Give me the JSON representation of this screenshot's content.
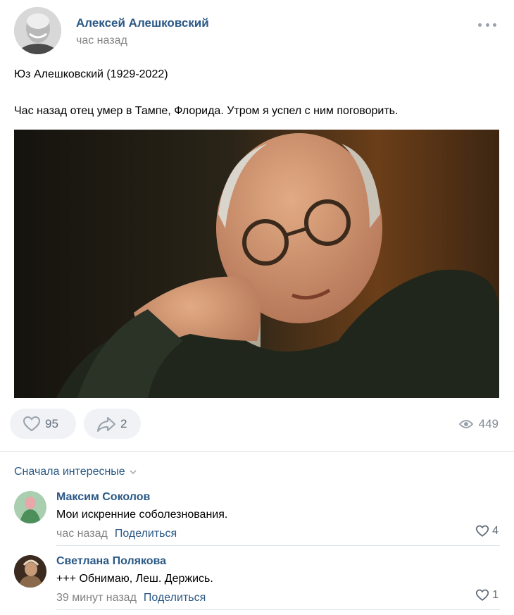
{
  "post": {
    "author": "Алексей Алешковский",
    "time": "час назад",
    "text_line1": "Юз Алешковский (1929-2022)",
    "text_line2": "Час назад отец умер в Тампе, Флорида. Утром я успел с ним поговорить.",
    "likes": "95",
    "shares": "2",
    "views": "449"
  },
  "comments_section": {
    "sort_label": "Сначала интересные",
    "share_label": "Поделиться",
    "comments": [
      {
        "name": "Максим Соколов",
        "text": "Мои искренние соболезнования.",
        "time": "час назад",
        "likes": "4"
      },
      {
        "name": "Светлана Полякова",
        "text": "+++ Обнимаю, Леш. Держись.",
        "time": "39 минут назад",
        "likes": "1"
      }
    ]
  },
  "colors": {
    "link": "#2a5885",
    "muted": "#828282",
    "button_bg": "#f0f2f5"
  },
  "icons": [
    "more-icon",
    "heart-icon",
    "share-arrow-icon",
    "eye-icon",
    "chevron-down-icon"
  ]
}
